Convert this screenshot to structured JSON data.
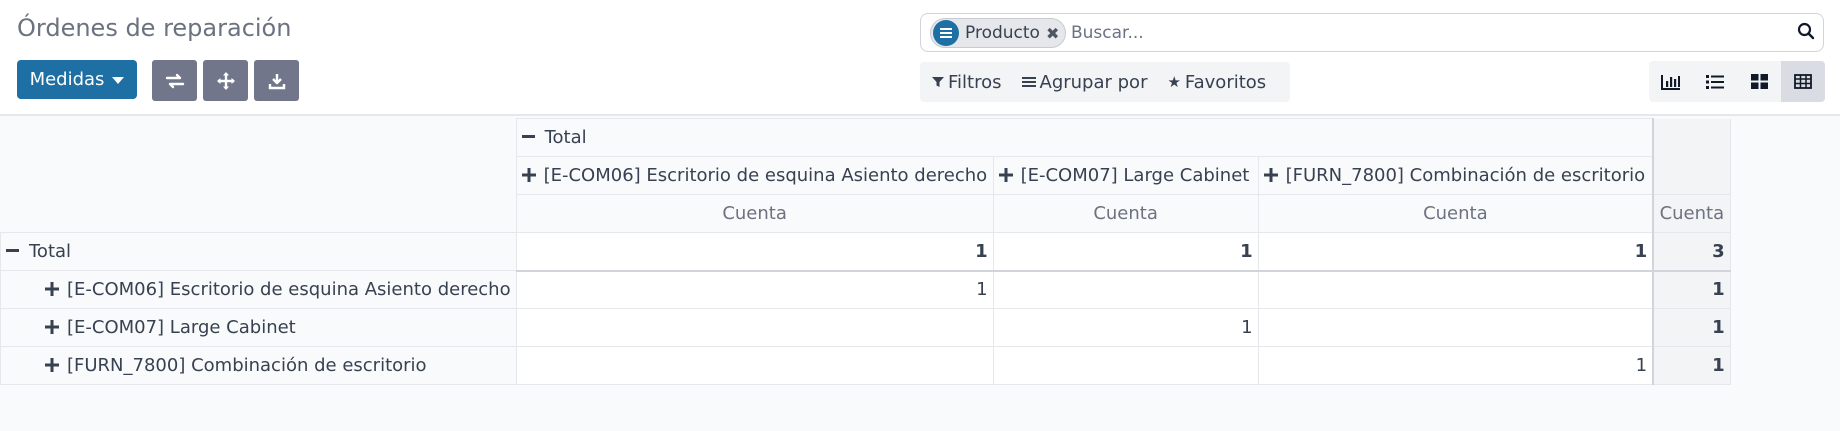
{
  "header": {
    "title": "Órdenes de reparación"
  },
  "toolbar": {
    "measures_label": "Medidas",
    "flip_axis_icon": "exchange-icon",
    "expand_all_icon": "arrows-expand-icon",
    "download_icon": "download-icon"
  },
  "search": {
    "facet_icon": "group-by-icon",
    "facet_label": "Producto",
    "facet_remove_icon": "close-icon",
    "placeholder": "Buscar...",
    "value": ""
  },
  "filters": {
    "filters_label": "Filtros",
    "group_by_label": "Agrupar por",
    "favorites_label": "Favoritos"
  },
  "views": [
    "graph",
    "list",
    "kanban",
    "pivot"
  ],
  "active_view": "pivot",
  "colors": {
    "primary": "#1e6fa3",
    "secondary_btn": "#71768a"
  },
  "pivot": {
    "column_total_label": "Total",
    "column_groups": [
      "[E-COM06] Escritorio de esquina Asiento derecho",
      "[E-COM07] Large Cabinet",
      "[FURN_7800] Combinación de escritorio"
    ],
    "measure_label": "Cuenta",
    "row_total_label": "Total",
    "total_row": {
      "values": [
        "1",
        "1",
        "1"
      ],
      "total": "3"
    },
    "rows": [
      {
        "label": "[E-COM06] Escritorio de esquina Asiento derecho",
        "values": [
          "1",
          "",
          ""
        ],
        "total": "1"
      },
      {
        "label": "[E-COM07] Large Cabinet",
        "values": [
          "",
          "1",
          ""
        ],
        "total": "1"
      },
      {
        "label": "[FURN_7800] Combinación de escritorio",
        "values": [
          "",
          "",
          "1"
        ],
        "total": "1"
      }
    ]
  }
}
